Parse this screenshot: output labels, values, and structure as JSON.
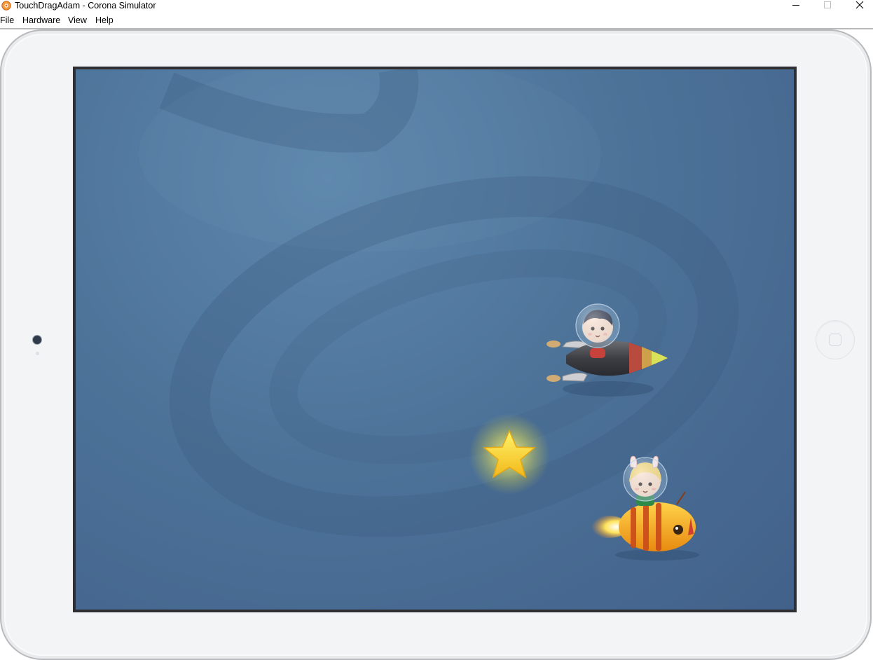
{
  "window": {
    "title": "TouchDragAdam - Corona Simulator",
    "app_icon": "corona-icon",
    "controls": [
      "minimize-icon",
      "maximize-icon",
      "close-icon"
    ]
  },
  "menu": {
    "items": [
      {
        "label": "File"
      },
      {
        "label": "Hardware"
      },
      {
        "label": "View"
      },
      {
        "label": "Help"
      }
    ]
  },
  "device": {
    "type": "tablet",
    "orientation": "landscape",
    "frame_color": "#f3f4f6",
    "screen_bg": "#4d7399"
  },
  "game": {
    "sprites": [
      {
        "name": "boy-astronaut-rocket",
        "description_icon": "rocket-sprite"
      },
      {
        "name": "glowing-star",
        "description_icon": "star-sprite"
      },
      {
        "name": "girl-astronaut-bee-rocket",
        "description_icon": "bee-rocket-sprite"
      }
    ]
  }
}
